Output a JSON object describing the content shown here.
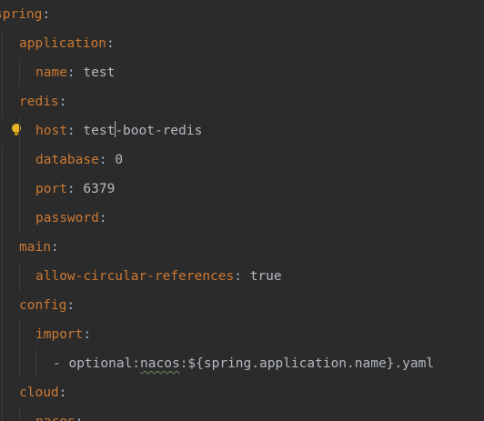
{
  "editor": {
    "lines": [
      {
        "key": "spring",
        "sep": ":",
        "val": ""
      },
      {
        "key": "application",
        "sep": ":",
        "val": ""
      },
      {
        "key": "name",
        "sep": ": ",
        "val": "test"
      },
      {
        "key": "redis",
        "sep": ":",
        "val": ""
      },
      {
        "key": "host",
        "sep": ": ",
        "val_before_caret": "test",
        "val_after_caret": "-boot-redis"
      },
      {
        "key": "database",
        "sep": ": ",
        "val": "0"
      },
      {
        "key": "port",
        "sep": ": ",
        "val": "6379"
      },
      {
        "key": "password",
        "sep": ":",
        "val": ""
      },
      {
        "key": "main",
        "sep": ":",
        "val": ""
      },
      {
        "key": "allow-circular-references",
        "sep": ": ",
        "val": "true"
      },
      {
        "key": "config",
        "sep": ":",
        "val": ""
      },
      {
        "key": "import",
        "sep": ":",
        "val": ""
      },
      {
        "dash": "- ",
        "pre": "optional:",
        "squig": "nacos",
        "post": ":${spring.application.name}.yaml"
      },
      {
        "key": "cloud",
        "sep": ":",
        "val": ""
      },
      {
        "key": "nacos",
        "sep": ":",
        "val": ""
      }
    ]
  },
  "icons": {
    "intention": "lightbulb-icon"
  },
  "colors": {
    "background": "#2b2b2b",
    "key": "#cc7832",
    "value": "#b4b9c0",
    "bulb": "#e6b422"
  }
}
